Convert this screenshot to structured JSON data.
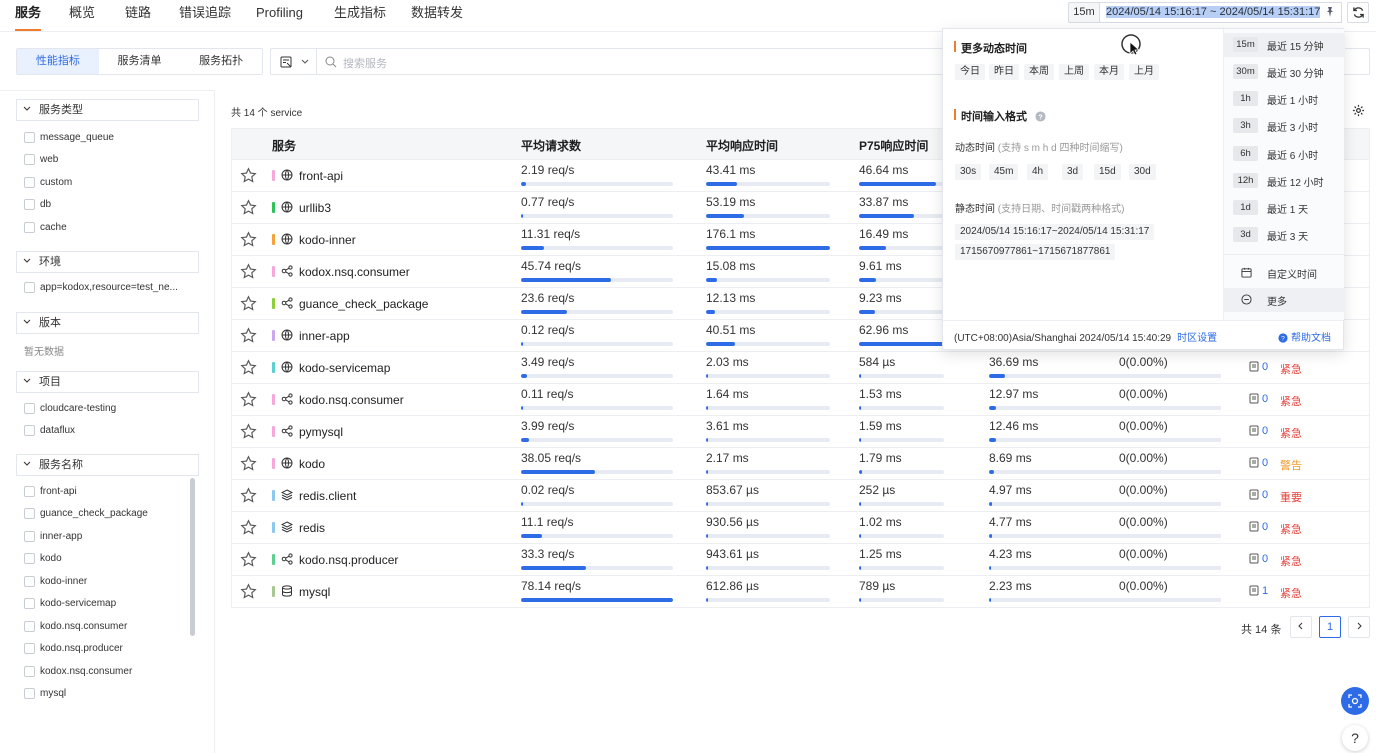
{
  "topnav": {
    "tabs": [
      "服务",
      "概览",
      "链路",
      "错误追踪",
      "Profiling",
      "生成指标",
      "数据转发"
    ],
    "range_badge": "15m",
    "range_text": "2024/05/14 15:16:17 ~ 2024/05/14 15:31:17"
  },
  "subtabs": [
    "性能指标",
    "服务清单",
    "服务拓扑"
  ],
  "search": {
    "placeholder": "搜索服务"
  },
  "sidebar": {
    "groups": [
      {
        "title": "服务类型",
        "options": [
          "message_queue",
          "web",
          "custom",
          "db",
          "cache"
        ]
      },
      {
        "title": "环境",
        "options": [
          "app=kodox,resource=test_ne..."
        ]
      },
      {
        "title": "版本",
        "empty": "暂无数据"
      },
      {
        "title": "项目",
        "options": [
          "cloudcare-testing",
          "dataflux"
        ]
      },
      {
        "title": "服务名称",
        "options": [
          "front-api",
          "guance_check_package",
          "inner-app",
          "kodo",
          "kodo-inner",
          "kodo-servicemap",
          "kodo.nsq.consumer",
          "kodo.nsq.producer",
          "kodox.nsq.consumer",
          "mysql"
        ]
      }
    ]
  },
  "table": {
    "count_text": "共 14 个 service",
    "headers": [
      "服务",
      "平均请求数",
      "平均响应时间",
      "P75响应时间"
    ],
    "rows": [
      {
        "name": "front-api",
        "icon": "globe-icon",
        "color": "#f6a8d8",
        "req": "2.19 req/s",
        "req_pct": 0.03,
        "avg": "43.41 ms",
        "avg_pct": 0.25,
        "p75": "46.64 ms",
        "p75_pct": 0.9,
        "p99": "",
        "p99_pct": 0,
        "err": "",
        "issues": "",
        "level": "",
        "level_color": ""
      },
      {
        "name": "urllib3",
        "icon": "globe-icon",
        "color": "#2fc25b",
        "req": "0.77 req/s",
        "req_pct": 0.01,
        "avg": "53.19 ms",
        "avg_pct": 0.31,
        "p75": "33.87 ms",
        "p75_pct": 0.65,
        "p99": "",
        "p99_pct": 0,
        "err": "",
        "issues": "",
        "level": "",
        "level_color": ""
      },
      {
        "name": "kodo-inner",
        "icon": "globe-icon",
        "color": "#f6a23a",
        "req": "11.31 req/s",
        "req_pct": 0.15,
        "avg": "176.1 ms",
        "avg_pct": 1.0,
        "p75": "16.49 ms",
        "p75_pct": 0.32,
        "p99": "",
        "p99_pct": 0,
        "err": "",
        "issues": "",
        "level": "",
        "level_color": ""
      },
      {
        "name": "kodox.nsq.consumer",
        "icon": "network-icon",
        "color": "#f6a8d8",
        "req": "45.74 req/s",
        "req_pct": 0.59,
        "avg": "15.08 ms",
        "avg_pct": 0.09,
        "p75": "9.61 ms",
        "p75_pct": 0.2,
        "p99": "",
        "p99_pct": 0,
        "err": "",
        "issues": "",
        "level": "",
        "level_color": ""
      },
      {
        "name": "guance_check_package",
        "icon": "network-icon",
        "color": "#8cd03b",
        "req": "23.6 req/s",
        "req_pct": 0.3,
        "avg": "12.13 ms",
        "avg_pct": 0.07,
        "p75": "9.23 ms",
        "p75_pct": 0.19,
        "p99": "",
        "p99_pct": 0,
        "err": "",
        "issues": "",
        "level": "",
        "level_color": ""
      },
      {
        "name": "inner-app",
        "icon": "globe-icon",
        "color": "#c9a8f0",
        "req": "0.12 req/s",
        "req_pct": 0.005,
        "avg": "40.51 ms",
        "avg_pct": 0.23,
        "p75": "62.96 ms",
        "p75_pct": 1.0,
        "p99": "",
        "p99_pct": 0,
        "err": "",
        "issues": "",
        "level": "",
        "level_color": ""
      },
      {
        "name": "kodo-servicemap",
        "icon": "globe-icon",
        "color": "#5ecfcf",
        "req": "3.49 req/s",
        "req_pct": 0.04,
        "avg": "2.03 ms",
        "avg_pct": 0.012,
        "p75": "584 µs",
        "p75_pct": 0.012,
        "p99": "36.69 ms",
        "p99_pct": 0.07,
        "err": "0(0.00%)",
        "issues": "0",
        "level": "紧急",
        "level_color": "#e8423a"
      },
      {
        "name": "kodo.nsq.consumer",
        "icon": "network-icon",
        "color": "#f6a8d8",
        "req": "0.11 req/s",
        "req_pct": 0.005,
        "avg": "1.64 ms",
        "avg_pct": 0.01,
        "p75": "1.53 ms",
        "p75_pct": 0.025,
        "p99": "12.97 ms",
        "p99_pct": 0.03,
        "err": "0(0.00%)",
        "issues": "0",
        "level": "紧急",
        "level_color": "#e8423a"
      },
      {
        "name": "pymysql",
        "icon": "network-icon",
        "color": "#f6a8d8",
        "req": "3.99 req/s",
        "req_pct": 0.05,
        "avg": "3.61 ms",
        "avg_pct": 0.02,
        "p75": "1.59 ms",
        "p75_pct": 0.025,
        "p99": "12.46 ms",
        "p99_pct": 0.03,
        "err": "0(0.00%)",
        "issues": "0",
        "level": "紧急",
        "level_color": "#e8423a"
      },
      {
        "name": "kodo",
        "icon": "globe-icon",
        "color": "#f6a8d8",
        "req": "38.05 req/s",
        "req_pct": 0.49,
        "avg": "2.17 ms",
        "avg_pct": 0.012,
        "p75": "1.79 ms",
        "p75_pct": 0.03,
        "p99": "8.69 ms",
        "p99_pct": 0.02,
        "err": "0(0.00%)",
        "issues": "0",
        "level": "警告",
        "level_color": "#f09a2a"
      },
      {
        "name": "redis.client",
        "icon": "layers-icon",
        "color": "#8cc8f0",
        "req": "0.02 req/s",
        "req_pct": 0.003,
        "avg": "853.67 µs",
        "avg_pct": 0.005,
        "p75": "252 µs",
        "p75_pct": 0.006,
        "p99": "4.97 ms",
        "p99_pct": 0.012,
        "err": "0(0.00%)",
        "issues": "0",
        "level": "重要",
        "level_color": "#e8423a"
      },
      {
        "name": "redis",
        "icon": "layers-icon",
        "color": "#8cc8f0",
        "req": "11.1 req/s",
        "req_pct": 0.14,
        "avg": "930.56 µs",
        "avg_pct": 0.005,
        "p75": "1.02 ms",
        "p75_pct": 0.017,
        "p99": "4.77 ms",
        "p99_pct": 0.011,
        "err": "0(0.00%)",
        "issues": "0",
        "level": "紧急",
        "level_color": "#e8423a"
      },
      {
        "name": "kodo.nsq.producer",
        "icon": "network-icon",
        "color": "#5ecf8e",
        "req": "33.3 req/s",
        "req_pct": 0.43,
        "avg": "943.61 µs",
        "avg_pct": 0.005,
        "p75": "1.25 ms",
        "p75_pct": 0.02,
        "p99": "4.23 ms",
        "p99_pct": 0.01,
        "err": "0(0.00%)",
        "issues": "0",
        "level": "紧急",
        "level_color": "#e8423a"
      },
      {
        "name": "mysql",
        "icon": "database-icon",
        "color": "#a8c890",
        "req": "78.14 req/s",
        "req_pct": 1.0,
        "avg": "612.86 µs",
        "avg_pct": 0.004,
        "p75": "789 µs",
        "p75_pct": 0.013,
        "p99": "2.23 ms",
        "p99_pct": 0.006,
        "err": "0(0.00%)",
        "issues": "1",
        "level": "紧急",
        "level_color": "#e8423a"
      }
    ]
  },
  "pagination": {
    "total": "共 14 条",
    "current": "1"
  },
  "dropdown": {
    "title1": "更多动态时间",
    "chips1": [
      "今日",
      "昨日",
      "本周",
      "上周",
      "本月",
      "上月"
    ],
    "title2": "时间输入格式",
    "dyn_label": "动态时间",
    "dyn_hint": "(支持 s m h d 四种时间缩写)",
    "chips2": [
      "30s",
      "45m",
      "4h",
      "3d",
      "15d",
      "30d"
    ],
    "static_label": "静态时间",
    "static_hint": "(支持日期、时间戳两种格式)",
    "static_ex1": "2024/05/14 15:16:17~2024/05/14 15:31:17",
    "static_ex2": "1715670977861~1715671877861",
    "quick": [
      {
        "badge": "15m",
        "label": "最近 15 分钟"
      },
      {
        "badge": "30m",
        "label": "最近 30 分钟"
      },
      {
        "badge": "1h",
        "label": "最近 1 小时"
      },
      {
        "badge": "3h",
        "label": "最近 3 小时"
      },
      {
        "badge": "6h",
        "label": "最近 6 小时"
      },
      {
        "badge": "12h",
        "label": "最近 12 小时"
      },
      {
        "badge": "1d",
        "label": "最近 1 天"
      },
      {
        "badge": "3d",
        "label": "最近 3 天"
      }
    ],
    "custom": "自定义时间",
    "more": "更多",
    "tz_text": "(UTC+08:00)Asia/Shanghai 2024/05/14 15:40:29",
    "tz_link": "时区设置",
    "help": "帮助文档"
  }
}
